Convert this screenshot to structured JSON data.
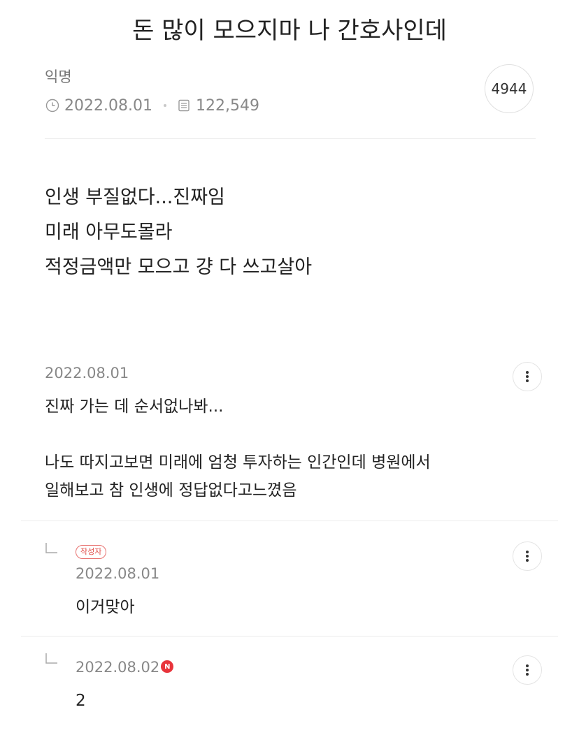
{
  "post": {
    "title": "돈 많이 모으지마 나 간호사인데",
    "author": "익명",
    "date": "2022.08.01",
    "views": "122,549",
    "comment_count": "4944",
    "body_lines": [
      "인생 부질없다...진짜임",
      "미래 아무도몰라",
      "적정금액만 모으고 걍 다 쓰고살아"
    ]
  },
  "comments": [
    {
      "date": "2022.08.01",
      "lines": [
        "진짜 가는 데 순서없나봐...",
        "",
        "나도 따지고보면 미래에 엄청 투자하는 인간인데 병원에서",
        "일해보고 참 인생에 정답없다고느꼈음"
      ]
    }
  ],
  "replies": [
    {
      "tag": "작성자",
      "date": "2022.08.01",
      "text": "이거맞아"
    },
    {
      "date": "2022.08.02",
      "new_badge": "N",
      "text": "2"
    }
  ],
  "icons": {
    "clock": "clock-icon",
    "views": "document-icon",
    "more": "more-vertical-icon",
    "reply": "reply-arrow-icon"
  },
  "colors": {
    "accent_red": "#e8343b",
    "tag_red": "#e04b47",
    "meta_gray": "#888888"
  }
}
